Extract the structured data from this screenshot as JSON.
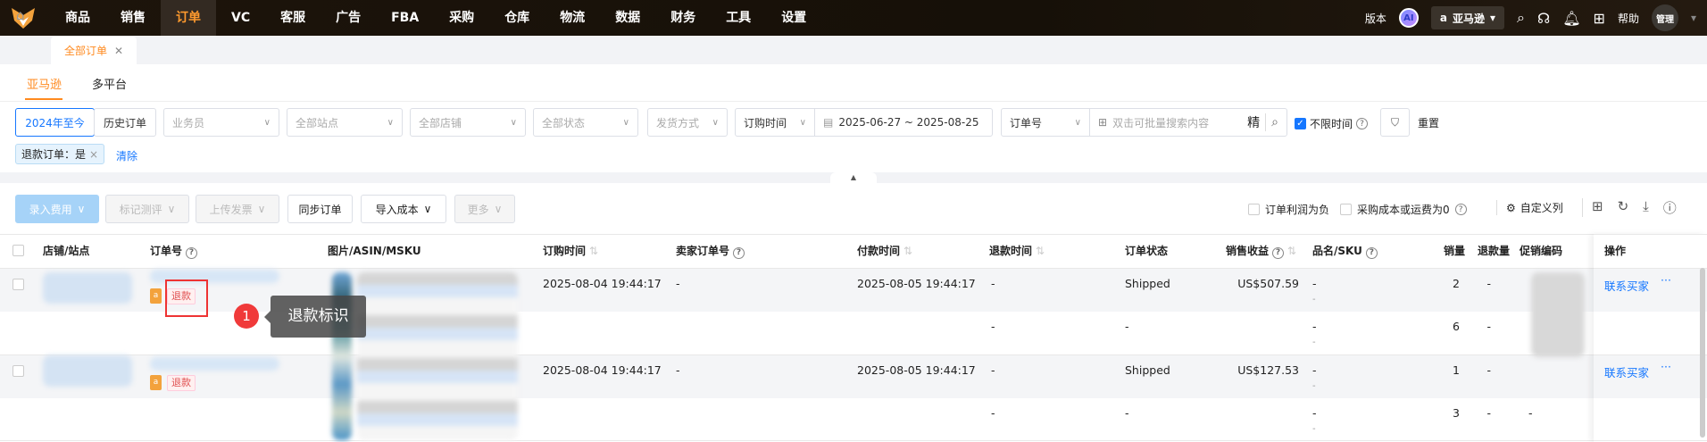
{
  "nav": {
    "items": [
      "商品",
      "销售",
      "订单",
      "VC",
      "客服",
      "广告",
      "FBA",
      "采购",
      "仓库",
      "物流",
      "数据",
      "财务",
      "工具",
      "设置"
    ],
    "active": "订单",
    "version": "版本",
    "ai": "AI",
    "platform": "亚马逊",
    "help": "帮助",
    "user": "管理"
  },
  "tabs": {
    "open": [
      {
        "label": "全部订单"
      }
    ]
  },
  "platform_tabs": [
    "亚马逊",
    "多平台"
  ],
  "filters": {
    "range_active": "2024年至今",
    "history": "历史订单",
    "salesperson": "业务员",
    "site": "全部站点",
    "shop": "全部店铺",
    "status": "全部状态",
    "ship": "发货方式",
    "time_type": "订购时间",
    "date_range": "2025-06-27 ~ 2025-08-25",
    "search_field": "订单号",
    "search_placeholder": "双击可批量搜索内容",
    "exact": "精",
    "unlimited": "不限时间",
    "reset": "重置"
  },
  "active_tag": {
    "label": "退款订单：是",
    "clear": "清除"
  },
  "toolbar": {
    "enter_fee": "录入费用",
    "mark_review": "标记测评",
    "upload_invoice": "上传发票",
    "sync": "同步订单",
    "import_cost": "导入成本",
    "more": "更多",
    "neg_profit": "订单利润为负",
    "zero_cost": "采购成本或运费为0",
    "custom_cols": "自定义列"
  },
  "columns": [
    "店铺/站点",
    "订单号",
    "图片/ASIN/MSKU",
    "订购时间",
    "卖家订单号",
    "付款时间",
    "退款时间",
    "订单状态",
    "销售收益",
    "品名/SKU",
    "销量",
    "退款量",
    "促销编码",
    "操作"
  ],
  "rows": [
    {
      "refund_tag": "退款",
      "order_time": "2025-08-04 19:44:17",
      "seller_no": "-",
      "pay_time": "2025-08-05 19:44:17",
      "refund_time": "-",
      "status": "Shipped",
      "revenue": "US$507.59",
      "sku": "-",
      "qty": "2",
      "refund_qty": "-",
      "action": "联系买家",
      "sub": {
        "refund_time": "-",
        "status": "-",
        "sku": "-",
        "qty": "6",
        "refund_qty": "-"
      }
    },
    {
      "refund_tag": "退款",
      "order_time": "2025-08-04 19:44:17",
      "seller_no": "-",
      "pay_time": "2025-08-05 19:44:17",
      "refund_time": "-",
      "status": "Shipped",
      "revenue": "US$127.53",
      "sku": "-",
      "qty": "1",
      "refund_qty": "-",
      "action": "联系买家",
      "sub": {
        "refund_time": "-",
        "status": "-",
        "sku": "-",
        "qty": "3",
        "refund_qty": "-",
        "promo": "-"
      }
    }
  ],
  "annotation": {
    "number": "1",
    "label": "退款标识",
    "color": "#f03a3a"
  }
}
